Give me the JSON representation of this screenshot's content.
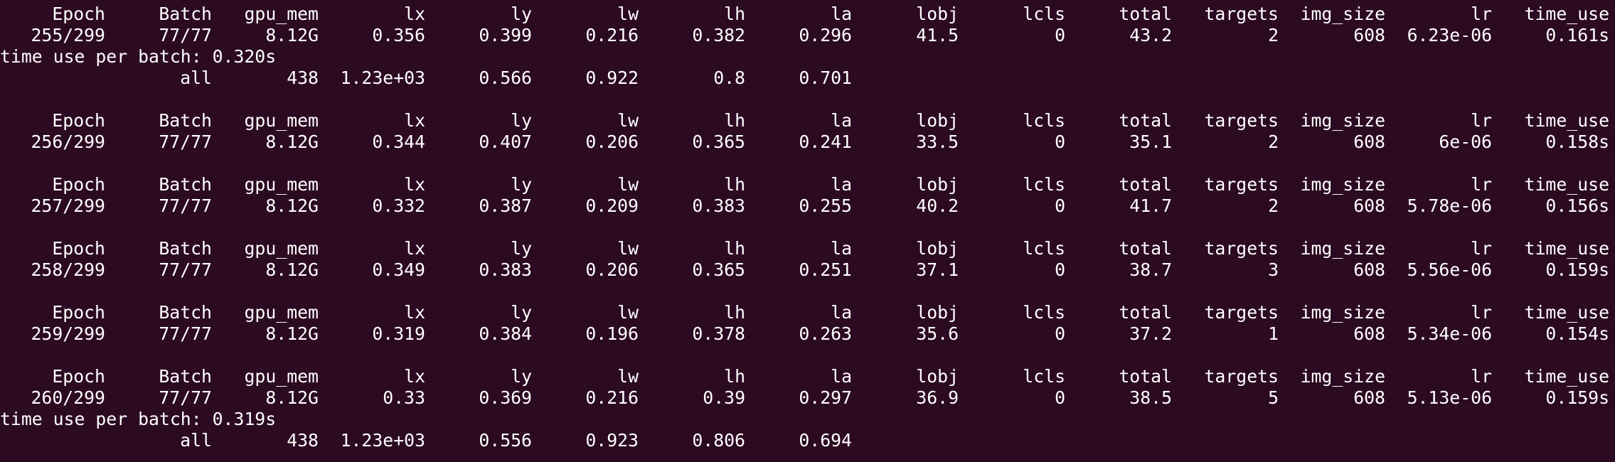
{
  "terminal": {
    "background": "#2c0a22",
    "foreground": "#ffffff",
    "header": [
      "Epoch",
      "Batch",
      "gpu_mem",
      "lx",
      "ly",
      "lw",
      "lh",
      "la",
      "lobj",
      "lcls",
      "total",
      "targets",
      "img_size",
      "lr",
      "time_use"
    ],
    "lines": [
      {
        "kind": "header"
      },
      {
        "kind": "row",
        "cells": [
          "255/299",
          "77/77",
          "8.12G",
          "0.356",
          "0.399",
          "0.216",
          "0.382",
          "0.296",
          "41.5",
          "0",
          "43.2",
          "2",
          "608",
          "6.23e-06",
          "0.161s"
        ]
      },
      {
        "kind": "text",
        "text": "time use per batch: 0.320s"
      },
      {
        "kind": "row",
        "cells": [
          "",
          "all",
          "438",
          "1.23e+03",
          "0.566",
          "0.922",
          "0.8",
          "0.701"
        ]
      },
      {
        "kind": "blank"
      },
      {
        "kind": "header"
      },
      {
        "kind": "row",
        "cells": [
          "256/299",
          "77/77",
          "8.12G",
          "0.344",
          "0.407",
          "0.206",
          "0.365",
          "0.241",
          "33.5",
          "0",
          "35.1",
          "2",
          "608",
          "6e-06",
          "0.158s"
        ]
      },
      {
        "kind": "blank"
      },
      {
        "kind": "header"
      },
      {
        "kind": "row",
        "cells": [
          "257/299",
          "77/77",
          "8.12G",
          "0.332",
          "0.387",
          "0.209",
          "0.383",
          "0.255",
          "40.2",
          "0",
          "41.7",
          "2",
          "608",
          "5.78e-06",
          "0.156s"
        ]
      },
      {
        "kind": "blank"
      },
      {
        "kind": "header"
      },
      {
        "kind": "row",
        "cells": [
          "258/299",
          "77/77",
          "8.12G",
          "0.349",
          "0.383",
          "0.206",
          "0.365",
          "0.251",
          "37.1",
          "0",
          "38.7",
          "3",
          "608",
          "5.56e-06",
          "0.159s"
        ]
      },
      {
        "kind": "blank"
      },
      {
        "kind": "header"
      },
      {
        "kind": "row",
        "cells": [
          "259/299",
          "77/77",
          "8.12G",
          "0.319",
          "0.384",
          "0.196",
          "0.378",
          "0.263",
          "35.6",
          "0",
          "37.2",
          "1",
          "608",
          "5.34e-06",
          "0.154s"
        ]
      },
      {
        "kind": "blank"
      },
      {
        "kind": "header"
      },
      {
        "kind": "row",
        "cells": [
          "260/299",
          "77/77",
          "8.12G",
          "0.33",
          "0.369",
          "0.216",
          "0.39",
          "0.297",
          "36.9",
          "0",
          "38.5",
          "5",
          "608",
          "5.13e-06",
          "0.159s"
        ]
      },
      {
        "kind": "text",
        "text": "time use per batch: 0.319s"
      },
      {
        "kind": "row",
        "cells": [
          "",
          "all",
          "438",
          "1.23e+03",
          "0.556",
          "0.923",
          "0.806",
          "0.694"
        ]
      }
    ]
  }
}
